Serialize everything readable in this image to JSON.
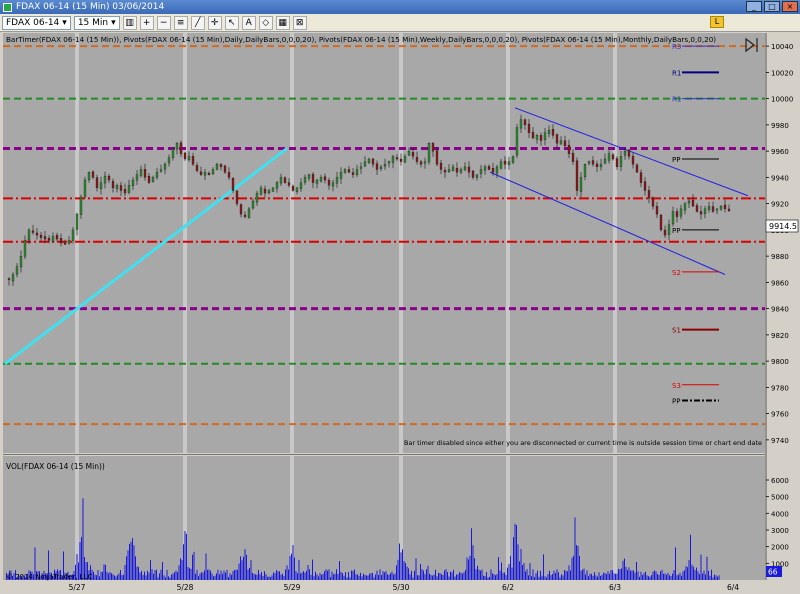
{
  "window": {
    "title": "FDAX 06-14 (15 Min)  03/06/2014"
  },
  "toolbar": {
    "instrument": "FDAX 06-14",
    "interval": "15 Min"
  },
  "indicator_label": "BarTimer(FDAX 06-14 (15 Min)), Pivots(FDAX 06-14 (15 Min),Daily,DailyBars,0,0,0,20), Pivots(FDAX 06-14 (15 Min),Weekly,DailyBars,0,0,0,20), Pivots(FDAX 06-14 (15 Min),Monthly,DailyBars,0,0,20)",
  "bar_timer_message": "Bar timer disabled since either you are disconnected or current time is outside session time or chart end date",
  "volume_label": "VOL(FDAX 06-14 (15 Min))",
  "copyright": "© 2014 NinjaTrader, LLC",
  "last_price_label": "9914.5",
  "volume_last_label": "66",
  "colors": {
    "bg": "#a8a8a8",
    "up": "#2e8b2e",
    "down": "#8b1a1a",
    "vol": "#1a1adb"
  },
  "chart_data": [
    {
      "type": "candlestick",
      "ylim": [
        9730,
        10050
      ],
      "yticks": [
        9740,
        9760,
        9780,
        9800,
        9820,
        9840,
        9860,
        9880,
        9900,
        9920,
        9940,
        9960,
        9980,
        10000,
        10020,
        10040
      ],
      "x_dates": [
        "5/27",
        "5/28",
        "5/29",
        "5/30",
        "6/2",
        "6/3",
        "6/4"
      ],
      "close_path": [
        [
          0,
          9862
        ],
        [
          4,
          9866
        ],
        [
          8,
          9872
        ],
        [
          12,
          9880
        ],
        [
          16,
          9892
        ],
        [
          20,
          9900
        ],
        [
          24,
          9898
        ],
        [
          28,
          9896
        ],
        [
          32,
          9894
        ],
        [
          36,
          9893
        ],
        [
          40,
          9892
        ],
        [
          44,
          9895
        ],
        [
          48,
          9893
        ],
        [
          52,
          9890
        ],
        [
          56,
          9889
        ],
        [
          60,
          9892
        ],
        [
          64,
          9900
        ],
        [
          68,
          9912
        ],
        [
          72,
          9925
        ],
        [
          76,
          9938
        ],
        [
          80,
          9944
        ],
        [
          84,
          9940
        ],
        [
          88,
          9932
        ],
        [
          92,
          9936
        ],
        [
          96,
          9941
        ],
        [
          100,
          9938
        ],
        [
          104,
          9932
        ],
        [
          108,
          9934
        ],
        [
          112,
          9930
        ],
        [
          116,
          9928
        ],
        [
          120,
          9934
        ],
        [
          124,
          9938
        ],
        [
          128,
          9942
        ],
        [
          132,
          9946
        ],
        [
          136,
          9940
        ],
        [
          140,
          9936
        ],
        [
          144,
          9940
        ],
        [
          148,
          9944
        ],
        [
          152,
          9946
        ],
        [
          156,
          9950
        ],
        [
          160,
          9955
        ],
        [
          164,
          9962
        ],
        [
          168,
          9966
        ],
        [
          172,
          9958
        ],
        [
          176,
          9954
        ],
        [
          180,
          9956
        ],
        [
          184,
          9950
        ],
        [
          188,
          9945
        ],
        [
          192,
          9942
        ],
        [
          196,
          9944
        ],
        [
          200,
          9942
        ],
        [
          204,
          9946
        ],
        [
          208,
          9950
        ],
        [
          212,
          9948
        ],
        [
          216,
          9944
        ],
        [
          220,
          9940
        ],
        [
          224,
          9930
        ],
        [
          228,
          9920
        ],
        [
          232,
          9912
        ],
        [
          236,
          9910
        ],
        [
          240,
          9916
        ],
        [
          244,
          9922
        ],
        [
          248,
          9928
        ],
        [
          252,
          9932
        ],
        [
          256,
          9928
        ],
        [
          260,
          9930
        ],
        [
          264,
          9932
        ],
        [
          268,
          9936
        ],
        [
          272,
          9940
        ],
        [
          276,
          9936
        ],
        [
          280,
          9934
        ],
        [
          284,
          9930
        ],
        [
          288,
          9932
        ],
        [
          292,
          9936
        ],
        [
          296,
          9940
        ],
        [
          300,
          9942
        ],
        [
          304,
          9936
        ],
        [
          308,
          9938
        ],
        [
          312,
          9940
        ],
        [
          316,
          9938
        ],
        [
          320,
          9934
        ],
        [
          324,
          9936
        ],
        [
          328,
          9940
        ],
        [
          332,
          9944
        ],
        [
          336,
          9946
        ],
        [
          340,
          9944
        ],
        [
          344,
          9942
        ],
        [
          348,
          9946
        ],
        [
          352,
          9948
        ],
        [
          356,
          9952
        ],
        [
          360,
          9954
        ],
        [
          364,
          9950
        ],
        [
          368,
          9946
        ],
        [
          372,
          9948
        ],
        [
          376,
          9950
        ],
        [
          380,
          9952
        ],
        [
          384,
          9956
        ],
        [
          388,
          9954
        ],
        [
          392,
          9952
        ],
        [
          396,
          9956
        ],
        [
          400,
          9960
        ],
        [
          404,
          9956
        ],
        [
          408,
          9952
        ],
        [
          412,
          9950
        ],
        [
          416,
          9952
        ],
        [
          420,
          9966
        ],
        [
          424,
          9960
        ],
        [
          428,
          9950
        ],
        [
          432,
          9946
        ],
        [
          436,
          9944
        ],
        [
          440,
          9946
        ],
        [
          444,
          9948
        ],
        [
          448,
          9944
        ],
        [
          452,
          9946
        ],
        [
          456,
          9948
        ],
        [
          460,
          9944
        ],
        [
          464,
          9940
        ],
        [
          468,
          9942
        ],
        [
          472,
          9946
        ],
        [
          476,
          9948
        ],
        [
          480,
          9946
        ],
        [
          484,
          9944
        ],
        [
          488,
          9948
        ],
        [
          492,
          9952
        ],
        [
          496,
          9950
        ],
        [
          500,
          9952
        ],
        [
          504,
          9956
        ],
        [
          508,
          9978
        ],
        [
          512,
          9984
        ],
        [
          516,
          9980
        ],
        [
          520,
          9974
        ],
        [
          524,
          9970
        ],
        [
          528,
          9972
        ],
        [
          532,
          9968
        ],
        [
          536,
          9974
        ],
        [
          540,
          9976
        ],
        [
          544,
          9972
        ],
        [
          548,
          9966
        ],
        [
          552,
          9968
        ],
        [
          556,
          9964
        ],
        [
          560,
          9958
        ],
        [
          564,
          9952
        ],
        [
          568,
          9930
        ],
        [
          572,
          9940
        ],
        [
          576,
          9950
        ],
        [
          580,
          9952
        ],
        [
          584,
          9950
        ],
        [
          588,
          9948
        ],
        [
          592,
          9950
        ],
        [
          596,
          9954
        ],
        [
          600,
          9958
        ],
        [
          604,
          9954
        ],
        [
          608,
          9948
        ],
        [
          612,
          9956
        ],
        [
          616,
          9960
        ],
        [
          620,
          9956
        ],
        [
          624,
          9950
        ],
        [
          628,
          9944
        ],
        [
          632,
          9936
        ],
        [
          636,
          9930
        ],
        [
          640,
          9924
        ],
        [
          644,
          9918
        ],
        [
          648,
          9912
        ],
        [
          652,
          9900
        ],
        [
          656,
          9896
        ],
        [
          660,
          9904
        ],
        [
          664,
          9914
        ],
        [
          668,
          9910
        ],
        [
          672,
          9916
        ],
        [
          676,
          9920
        ],
        [
          680,
          9922
        ],
        [
          684,
          9918
        ],
        [
          688,
          9914
        ],
        [
          692,
          9912
        ],
        [
          696,
          9916
        ],
        [
          700,
          9918
        ],
        [
          704,
          9914
        ],
        [
          708,
          9916
        ],
        [
          712,
          9918
        ],
        [
          716,
          9916
        ],
        [
          720,
          9914.5
        ]
      ],
      "pivots": [
        {
          "level": 10040,
          "color": "#d2691e",
          "style": "dash",
          "width": 2
        },
        {
          "level": 10000,
          "color": "#228b22",
          "style": "dash",
          "width": 2
        },
        {
          "level": 9962,
          "color": "#8b008b",
          "style": "dash",
          "width": 3
        },
        {
          "level": 9924,
          "color": "#dc0000",
          "style": "dashdot",
          "width": 2
        },
        {
          "level": 9891,
          "color": "#dc0000",
          "style": "dashdot",
          "width": 2
        },
        {
          "level": 9840,
          "color": "#8b008b",
          "style": "dash",
          "width": 3
        },
        {
          "level": 9798,
          "color": "#228b22",
          "style": "dash",
          "width": 2
        },
        {
          "level": 9752,
          "color": "#d2691e",
          "style": "dash",
          "width": 2
        }
      ],
      "daily_pivot_labels": [
        {
          "text": "R3",
          "level": 10040,
          "color": "#3333cc"
        },
        {
          "text": "R1",
          "level": 10020,
          "color": "#000080"
        },
        {
          "text": "R1",
          "level": 10000,
          "color": "#3333cc"
        },
        {
          "text": "PP",
          "level": 9954,
          "color": "#000000"
        },
        {
          "text": "PP",
          "level": 9900,
          "color": "#000000"
        },
        {
          "text": "S2",
          "level": 9868,
          "color": "#dc0000"
        },
        {
          "text": "S1",
          "level": 9824,
          "color": "#8b0000"
        },
        {
          "text": "S3",
          "level": 9782,
          "color": "#dc0000"
        },
        {
          "text": "PP",
          "level": 9770,
          "color": "#000000"
        }
      ],
      "trendlines": [
        {
          "x1": 5,
          "y1": 9798,
          "x2": 287,
          "y2": 9962,
          "color": "#40e0f0",
          "width": 3
        },
        {
          "x1": 515,
          "y1": 9993,
          "x2": 748,
          "y2": 9926,
          "color": "#2020e0",
          "width": 1
        },
        {
          "x1": 490,
          "y1": 9944,
          "x2": 725,
          "y2": 9866,
          "color": "#2020e0",
          "width": 1
        }
      ]
    },
    {
      "type": "bar",
      "name": "VOL",
      "ylim": [
        0,
        6600
      ],
      "yticks": [
        1000,
        2000,
        3000,
        4000,
        5000,
        6000
      ],
      "volume_peaks": [
        [
          82,
          5000
        ],
        [
          131,
          3600
        ],
        [
          185,
          3600
        ],
        [
          243,
          3300
        ],
        [
          292,
          2800
        ],
        [
          401,
          3100
        ],
        [
          471,
          3600
        ],
        [
          516,
          5000
        ],
        [
          575,
          4000
        ],
        [
          623,
          2800
        ],
        [
          690,
          2500
        ]
      ]
    }
  ]
}
